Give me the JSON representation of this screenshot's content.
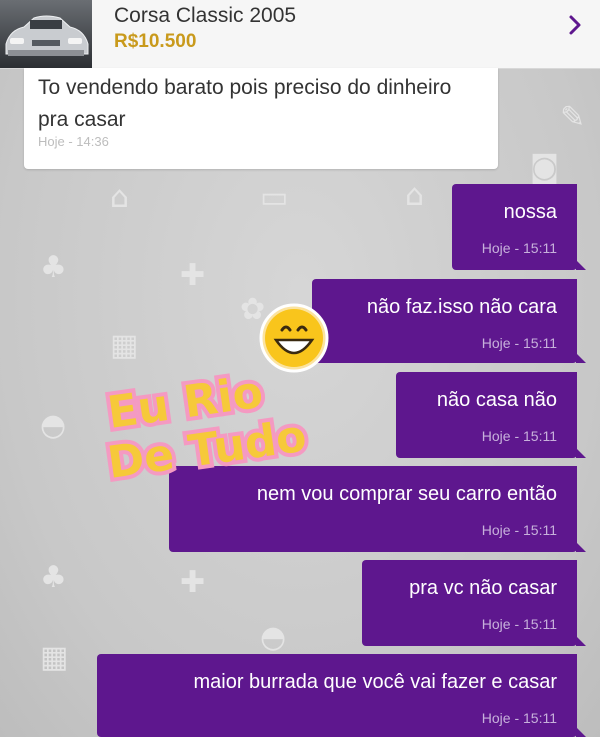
{
  "header": {
    "title": "Corsa Classic 2005",
    "price": "R$10.500",
    "thumbnail_icon": "car-photo",
    "chevron_icon": "chevron-right-icon"
  },
  "received": {
    "text": "To vendendo barato pois preciso do dinheiro pra casar",
    "time": "Hoje - 14:36"
  },
  "sent": [
    {
      "text": "nossa",
      "time": "Hoje - 15:11"
    },
    {
      "text": "não faz.isso não cara",
      "time": "Hoje - 15:11"
    },
    {
      "text": "não casa não",
      "time": "Hoje - 15:11"
    },
    {
      "text": "nem vou comprar seu carro então",
      "time": "Hoje - 15:11"
    },
    {
      "text": "pra vc não casar",
      "time": "Hoje - 15:11"
    },
    {
      "text": "maior burrada que você vai fazer e casar",
      "time": "Hoje - 15:11"
    }
  ],
  "watermark": {
    "line1": "Eu Rio",
    "line2": "De Tudo",
    "emoji": "grinning-face"
  },
  "colors": {
    "sent_bubble": "#5e178e",
    "price": "#c99a1c",
    "header_bg": "#f6f6f6",
    "chat_bg": "#cfcfcf"
  }
}
